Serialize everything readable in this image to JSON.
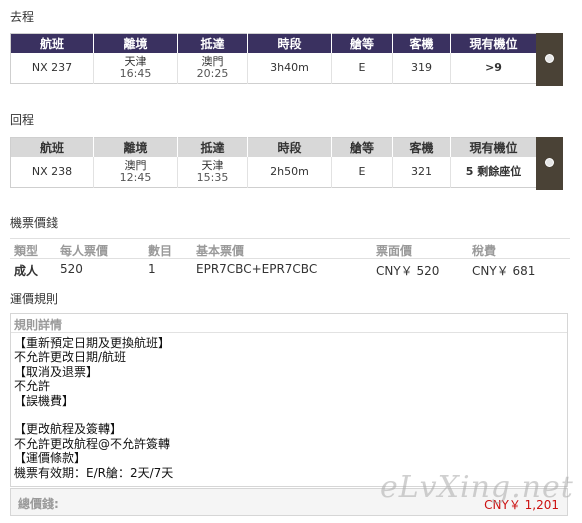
{
  "outbound": {
    "section_label": "去程",
    "headers": [
      "航班",
      "離境",
      "抵達",
      "時段",
      "艙等",
      "客機",
      "現有機位"
    ],
    "flight": "NX 237",
    "dep_city": "天津",
    "dep_time": "16:45",
    "arr_city": "澳門",
    "arr_time": "20:25",
    "duration": "3h40m",
    "cabin": "E",
    "aircraft": "319",
    "availability": ">9"
  },
  "return": {
    "section_label": "回程",
    "headers": [
      "航班",
      "離境",
      "抵達",
      "時段",
      "艙等",
      "客機",
      "現有機位"
    ],
    "flight": "NX 238",
    "dep_city": "澳門",
    "dep_time": "12:45",
    "arr_city": "天津",
    "arr_time": "15:35",
    "duration": "2h50m",
    "cabin": "E",
    "aircraft": "321",
    "availability": "5 剩餘座位"
  },
  "pricing": {
    "section_label": "機票價錢",
    "headers": [
      "類型",
      "每人票價",
      "數目",
      "基本票價",
      "票面價",
      "稅費"
    ],
    "row": [
      "成人",
      "520",
      "1",
      "EPR7CBC+EPR7CBC",
      "CNY￥ 520",
      "CNY￥ 681"
    ]
  },
  "rules": {
    "section_label": "運價規則",
    "title": "規則詳情",
    "lines": [
      "【重新預定日期及更換航班】",
      "不允許更改日期/航班",
      "【取消及退票】",
      "不允許",
      "【誤機費】",
      "",
      "【更改航程及簽轉】",
      "不允許更改航程@不允許簽轉",
      "【運價條款】",
      "機票有效期：E/R艙：2天/7天"
    ]
  },
  "total": {
    "label": "總價錢:",
    "value": "CNY￥ 1,201"
  },
  "watermark": "eLvXing.net",
  "colors": {
    "outbound_header": "#3a3160",
    "return_header": "#d8d8d8",
    "availability_good": "#1f6f98",
    "availability_low": "#cc1111",
    "total_price": "#cc1111"
  }
}
